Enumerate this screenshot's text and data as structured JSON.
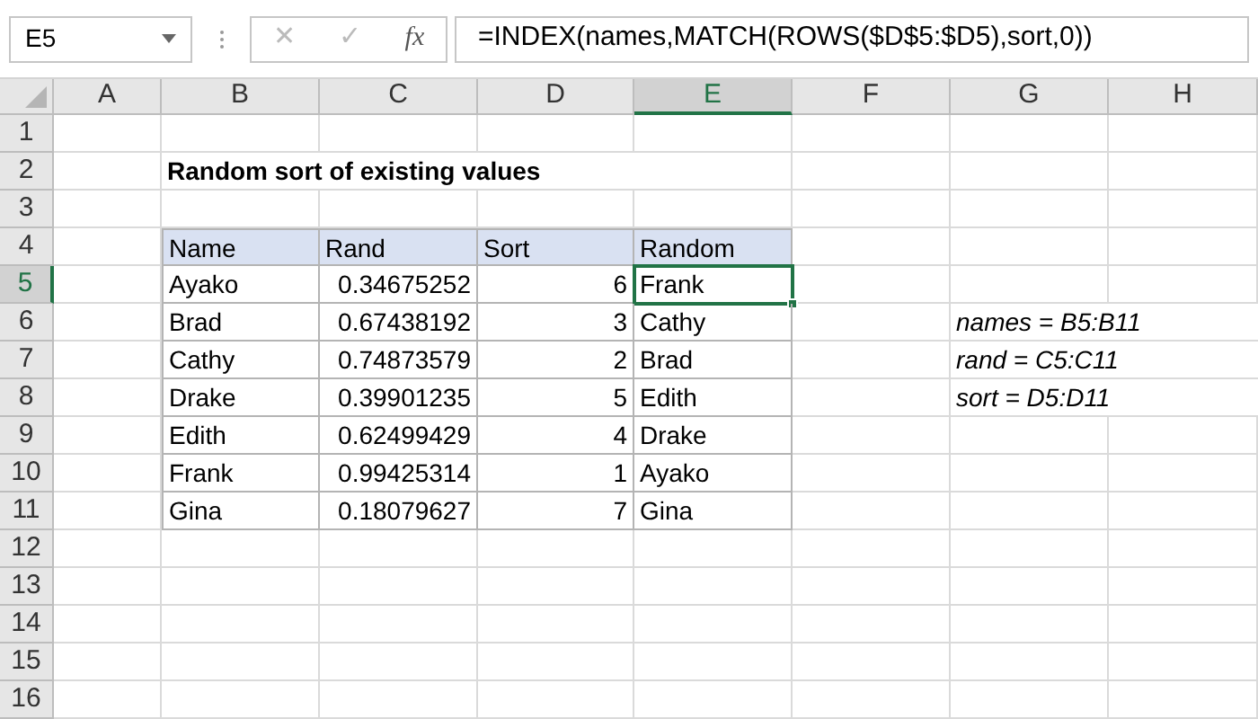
{
  "name_box": "E5",
  "formula_bar": {
    "cancel": "✕",
    "enter": "✓",
    "fx": "fx",
    "formula": "=INDEX(names,MATCH(ROWS($D$5:$D5),sort,0))"
  },
  "columns": [
    {
      "label": "A",
      "selected": false
    },
    {
      "label": "B",
      "selected": false
    },
    {
      "label": "C",
      "selected": false
    },
    {
      "label": "D",
      "selected": false
    },
    {
      "label": "E",
      "selected": true
    },
    {
      "label": "F",
      "selected": false
    },
    {
      "label": "G",
      "selected": false
    },
    {
      "label": "H",
      "selected": false
    }
  ],
  "rows": [
    {
      "label": "1",
      "selected": false
    },
    {
      "label": "2",
      "selected": false
    },
    {
      "label": "3",
      "selected": false
    },
    {
      "label": "4",
      "selected": false
    },
    {
      "label": "5",
      "selected": true
    },
    {
      "label": "6",
      "selected": false
    },
    {
      "label": "7",
      "selected": false
    },
    {
      "label": "8",
      "selected": false
    },
    {
      "label": "9",
      "selected": false
    },
    {
      "label": "10",
      "selected": false
    },
    {
      "label": "11",
      "selected": false
    },
    {
      "label": "12",
      "selected": false
    },
    {
      "label": "13",
      "selected": false
    },
    {
      "label": "14",
      "selected": false
    },
    {
      "label": "15",
      "selected": false
    },
    {
      "label": "16",
      "selected": false
    }
  ],
  "title": "Random sort of existing values",
  "table": {
    "columns": [
      {
        "label": "Name",
        "kind": "text"
      },
      {
        "label": "Rand",
        "kind": "number"
      },
      {
        "label": "Sort",
        "kind": "number"
      },
      {
        "label": "Random",
        "kind": "text"
      }
    ],
    "rows": [
      [
        {
          "text": "Ayako",
          "selected": false
        },
        {
          "text": "0.34675252",
          "selected": false
        },
        {
          "text": "6",
          "selected": false
        },
        {
          "text": "Frank",
          "selected": true
        }
      ],
      [
        {
          "text": "Brad",
          "selected": false
        },
        {
          "text": "0.67438192",
          "selected": false
        },
        {
          "text": "3",
          "selected": false
        },
        {
          "text": "Cathy",
          "selected": false
        }
      ],
      [
        {
          "text": "Cathy",
          "selected": false
        },
        {
          "text": "0.74873579",
          "selected": false
        },
        {
          "text": "2",
          "selected": false
        },
        {
          "text": "Brad",
          "selected": false
        }
      ],
      [
        {
          "text": "Drake",
          "selected": false
        },
        {
          "text": "0.39901235",
          "selected": false
        },
        {
          "text": "5",
          "selected": false
        },
        {
          "text": "Edith",
          "selected": false
        }
      ],
      [
        {
          "text": "Edith",
          "selected": false
        },
        {
          "text": "0.62499429",
          "selected": false
        },
        {
          "text": "4",
          "selected": false
        },
        {
          "text": "Drake",
          "selected": false
        }
      ],
      [
        {
          "text": "Frank",
          "selected": false
        },
        {
          "text": "0.99425314",
          "selected": false
        },
        {
          "text": "1",
          "selected": false
        },
        {
          "text": "Ayako",
          "selected": false
        }
      ],
      [
        {
          "text": "Gina",
          "selected": false
        },
        {
          "text": "0.18079627",
          "selected": false
        },
        {
          "text": "7",
          "selected": false
        },
        {
          "text": "Gina",
          "selected": false
        }
      ]
    ]
  },
  "notes": [
    "names = B5:B11",
    "rand = C5:C11",
    "sort = D5:D11"
  ]
}
